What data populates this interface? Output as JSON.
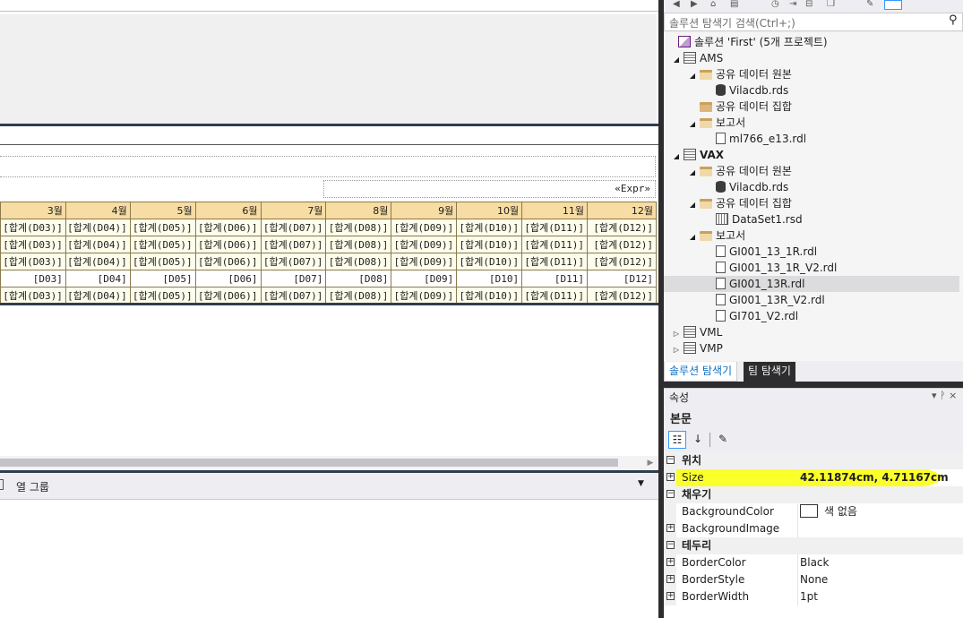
{
  "report": {
    "expr": "«Expr»",
    "months": [
      "3월",
      "4월",
      "5월",
      "6월",
      "7월",
      "8월",
      "9월",
      "10월",
      "11월",
      "12월"
    ],
    "rows": [
      [
        "[합계(D03)]",
        "[합계(D04)]",
        "[합계(D05)]",
        "[합계(D06)]",
        "[합계(D07)]",
        "[합계(D08)]",
        "[합계(D09)]",
        "[합계(D10)]",
        "[합계(D11)]",
        "[합계(D12)]"
      ],
      [
        "[합계(D03)]",
        "[합계(D04)]",
        "[합계(D05)]",
        "[합계(D06)]",
        "[합계(D07)]",
        "[합계(D08)]",
        "[합계(D09)]",
        "[합계(D10)]",
        "[합계(D11)]",
        "[합계(D12)]"
      ],
      [
        "[합계(D03)]",
        "[합계(D04)]",
        "[합계(D05)]",
        "[합계(D06)]",
        "[합계(D07)]",
        "[합계(D08)]",
        "[합계(D09)]",
        "[합계(D10)]",
        "[합계(D11)]",
        "[합계(D12)]"
      ],
      [
        "[D03]",
        "[D04]",
        "[D05]",
        "[D06]",
        "[D07]",
        "[D08]",
        "[D09]",
        "[D10]",
        "[D11]",
        "[D12]"
      ],
      [
        "[합계(D03)]",
        "[합계(D04)]",
        "[합계(D05)]",
        "[합계(D06)]",
        "[합계(D07)]",
        "[합계(D08)]",
        "[합계(D09)]",
        "[합계(D10)]",
        "[합계(D11)]",
        "[합계(D12)]"
      ]
    ],
    "white_row_index": 3
  },
  "grouping": {
    "column_groups_label": "열 그룹"
  },
  "solution_explorer": {
    "search_placeholder": "솔루션 탐색기 검색(Ctrl+;)",
    "tree": [
      {
        "label": "솔루션 'First' (5개 프로젝트)",
        "icon": "solution-icon",
        "indent": 0,
        "twisty": ""
      },
      {
        "label": "AMS",
        "icon": "project-icon",
        "indent": 1,
        "twisty": "◢"
      },
      {
        "label": "공유 데이터 원본",
        "icon": "folder-open-icon",
        "indent": 2,
        "twisty": "◢"
      },
      {
        "label": "Vilacdb.rds",
        "icon": "datasource-icon",
        "indent": 3,
        "twisty": ""
      },
      {
        "label": "공유 데이터 집합",
        "icon": "folder-icon",
        "indent": 2,
        "twisty": ""
      },
      {
        "label": "보고서",
        "icon": "folder-open-icon",
        "indent": 2,
        "twisty": "◢"
      },
      {
        "label": "ml766_e13.rdl",
        "icon": "report-icon",
        "indent": 3,
        "twisty": ""
      },
      {
        "label": "VAX",
        "icon": "project-icon",
        "indent": 1,
        "twisty": "◢",
        "bold": true
      },
      {
        "label": "공유 데이터 원본",
        "icon": "folder-open-icon",
        "indent": 2,
        "twisty": "◢"
      },
      {
        "label": "Vilacdb.rds",
        "icon": "datasource-icon",
        "indent": 3,
        "twisty": ""
      },
      {
        "label": "공유 데이터 집합",
        "icon": "folder-open-icon",
        "indent": 2,
        "twisty": "◢"
      },
      {
        "label": "DataSet1.rsd",
        "icon": "dataset-icon",
        "indent": 3,
        "twisty": ""
      },
      {
        "label": "보고서",
        "icon": "folder-open-icon",
        "indent": 2,
        "twisty": "◢"
      },
      {
        "label": "GI001_13_1R.rdl",
        "icon": "report-icon",
        "indent": 3,
        "twisty": ""
      },
      {
        "label": "GI001_13_1R_V2.rdl",
        "icon": "report-icon",
        "indent": 3,
        "twisty": ""
      },
      {
        "label": "GI001_13R.rdl",
        "icon": "report-icon",
        "indent": 3,
        "twisty": "",
        "selected": true
      },
      {
        "label": "GI001_13R_V2.rdl",
        "icon": "report-icon",
        "indent": 3,
        "twisty": ""
      },
      {
        "label": "GI701_V2.rdl",
        "icon": "report-icon",
        "indent": 3,
        "twisty": ""
      },
      {
        "label": "VML",
        "icon": "project-icon",
        "indent": 1,
        "twisty": "▷"
      },
      {
        "label": "VMP",
        "icon": "project-icon",
        "indent": 1,
        "twisty": "▷"
      }
    ],
    "tabs": [
      "솔루션 탐색기",
      "팀 탐색기"
    ]
  },
  "properties": {
    "title": "속성",
    "title_buttons": "▾ ᚹ ×",
    "selected_object": "본문",
    "rows": [
      {
        "type": "category",
        "name": "위치"
      },
      {
        "type": "prop",
        "name": "Size",
        "value": "42.11874cm, 4.71167cm",
        "expandable": true,
        "bold_value": true
      },
      {
        "type": "category",
        "name": "채우기"
      },
      {
        "type": "prop",
        "name": "BackgroundColor",
        "value": "색 없음",
        "swatch": true
      },
      {
        "type": "prop",
        "name": "BackgroundImage",
        "value": "",
        "expandable": true
      },
      {
        "type": "category",
        "name": "테두리"
      },
      {
        "type": "prop",
        "name": "BorderColor",
        "value": "Black",
        "expandable": true
      },
      {
        "type": "prop",
        "name": "BorderStyle",
        "value": "None",
        "expandable": true
      },
      {
        "type": "prop",
        "name": "BorderWidth",
        "value": "1pt",
        "expandable": true
      }
    ]
  },
  "colors": {
    "header_cell": "#f7dca3",
    "body_cell": "#fefcea",
    "highlight": "#fbff2a",
    "dark_chrome": "#2d2d30"
  }
}
